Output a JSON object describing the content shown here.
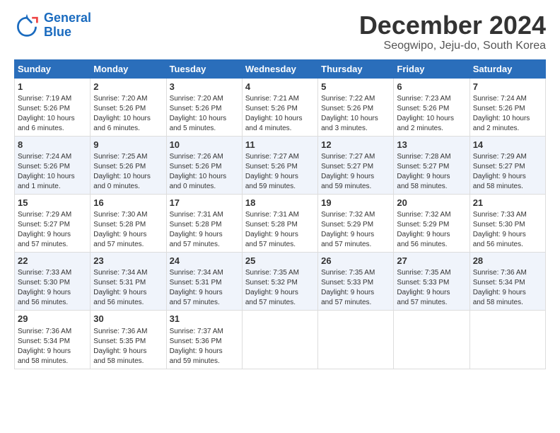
{
  "logo": {
    "line1": "General",
    "line2": "Blue"
  },
  "title": "December 2024",
  "subtitle": "Seogwipo, Jeju-do, South Korea",
  "header_days": [
    "Sunday",
    "Monday",
    "Tuesday",
    "Wednesday",
    "Thursday",
    "Friday",
    "Saturday"
  ],
  "weeks": [
    [
      {
        "day": "1",
        "lines": [
          "Sunrise: 7:19 AM",
          "Sunset: 5:26 PM",
          "Daylight: 10 hours",
          "and 6 minutes."
        ]
      },
      {
        "day": "2",
        "lines": [
          "Sunrise: 7:20 AM",
          "Sunset: 5:26 PM",
          "Daylight: 10 hours",
          "and 6 minutes."
        ]
      },
      {
        "day": "3",
        "lines": [
          "Sunrise: 7:20 AM",
          "Sunset: 5:26 PM",
          "Daylight: 10 hours",
          "and 5 minutes."
        ]
      },
      {
        "day": "4",
        "lines": [
          "Sunrise: 7:21 AM",
          "Sunset: 5:26 PM",
          "Daylight: 10 hours",
          "and 4 minutes."
        ]
      },
      {
        "day": "5",
        "lines": [
          "Sunrise: 7:22 AM",
          "Sunset: 5:26 PM",
          "Daylight: 10 hours",
          "and 3 minutes."
        ]
      },
      {
        "day": "6",
        "lines": [
          "Sunrise: 7:23 AM",
          "Sunset: 5:26 PM",
          "Daylight: 10 hours",
          "and 2 minutes."
        ]
      },
      {
        "day": "7",
        "lines": [
          "Sunrise: 7:24 AM",
          "Sunset: 5:26 PM",
          "Daylight: 10 hours",
          "and 2 minutes."
        ]
      }
    ],
    [
      {
        "day": "8",
        "lines": [
          "Sunrise: 7:24 AM",
          "Sunset: 5:26 PM",
          "Daylight: 10 hours",
          "and 1 minute."
        ]
      },
      {
        "day": "9",
        "lines": [
          "Sunrise: 7:25 AM",
          "Sunset: 5:26 PM",
          "Daylight: 10 hours",
          "and 0 minutes."
        ]
      },
      {
        "day": "10",
        "lines": [
          "Sunrise: 7:26 AM",
          "Sunset: 5:26 PM",
          "Daylight: 10 hours",
          "and 0 minutes."
        ]
      },
      {
        "day": "11",
        "lines": [
          "Sunrise: 7:27 AM",
          "Sunset: 5:26 PM",
          "Daylight: 9 hours",
          "and 59 minutes."
        ]
      },
      {
        "day": "12",
        "lines": [
          "Sunrise: 7:27 AM",
          "Sunset: 5:27 PM",
          "Daylight: 9 hours",
          "and 59 minutes."
        ]
      },
      {
        "day": "13",
        "lines": [
          "Sunrise: 7:28 AM",
          "Sunset: 5:27 PM",
          "Daylight: 9 hours",
          "and 58 minutes."
        ]
      },
      {
        "day": "14",
        "lines": [
          "Sunrise: 7:29 AM",
          "Sunset: 5:27 PM",
          "Daylight: 9 hours",
          "and 58 minutes."
        ]
      }
    ],
    [
      {
        "day": "15",
        "lines": [
          "Sunrise: 7:29 AM",
          "Sunset: 5:27 PM",
          "Daylight: 9 hours",
          "and 57 minutes."
        ]
      },
      {
        "day": "16",
        "lines": [
          "Sunrise: 7:30 AM",
          "Sunset: 5:28 PM",
          "Daylight: 9 hours",
          "and 57 minutes."
        ]
      },
      {
        "day": "17",
        "lines": [
          "Sunrise: 7:31 AM",
          "Sunset: 5:28 PM",
          "Daylight: 9 hours",
          "and 57 minutes."
        ]
      },
      {
        "day": "18",
        "lines": [
          "Sunrise: 7:31 AM",
          "Sunset: 5:28 PM",
          "Daylight: 9 hours",
          "and 57 minutes."
        ]
      },
      {
        "day": "19",
        "lines": [
          "Sunrise: 7:32 AM",
          "Sunset: 5:29 PM",
          "Daylight: 9 hours",
          "and 57 minutes."
        ]
      },
      {
        "day": "20",
        "lines": [
          "Sunrise: 7:32 AM",
          "Sunset: 5:29 PM",
          "Daylight: 9 hours",
          "and 56 minutes."
        ]
      },
      {
        "day": "21",
        "lines": [
          "Sunrise: 7:33 AM",
          "Sunset: 5:30 PM",
          "Daylight: 9 hours",
          "and 56 minutes."
        ]
      }
    ],
    [
      {
        "day": "22",
        "lines": [
          "Sunrise: 7:33 AM",
          "Sunset: 5:30 PM",
          "Daylight: 9 hours",
          "and 56 minutes."
        ]
      },
      {
        "day": "23",
        "lines": [
          "Sunrise: 7:34 AM",
          "Sunset: 5:31 PM",
          "Daylight: 9 hours",
          "and 56 minutes."
        ]
      },
      {
        "day": "24",
        "lines": [
          "Sunrise: 7:34 AM",
          "Sunset: 5:31 PM",
          "Daylight: 9 hours",
          "and 57 minutes."
        ]
      },
      {
        "day": "25",
        "lines": [
          "Sunrise: 7:35 AM",
          "Sunset: 5:32 PM",
          "Daylight: 9 hours",
          "and 57 minutes."
        ]
      },
      {
        "day": "26",
        "lines": [
          "Sunrise: 7:35 AM",
          "Sunset: 5:33 PM",
          "Daylight: 9 hours",
          "and 57 minutes."
        ]
      },
      {
        "day": "27",
        "lines": [
          "Sunrise: 7:35 AM",
          "Sunset: 5:33 PM",
          "Daylight: 9 hours",
          "and 57 minutes."
        ]
      },
      {
        "day": "28",
        "lines": [
          "Sunrise: 7:36 AM",
          "Sunset: 5:34 PM",
          "Daylight: 9 hours",
          "and 58 minutes."
        ]
      }
    ],
    [
      {
        "day": "29",
        "lines": [
          "Sunrise: 7:36 AM",
          "Sunset: 5:34 PM",
          "Daylight: 9 hours",
          "and 58 minutes."
        ]
      },
      {
        "day": "30",
        "lines": [
          "Sunrise: 7:36 AM",
          "Sunset: 5:35 PM",
          "Daylight: 9 hours",
          "and 58 minutes."
        ]
      },
      {
        "day": "31",
        "lines": [
          "Sunrise: 7:37 AM",
          "Sunset: 5:36 PM",
          "Daylight: 9 hours",
          "and 59 minutes."
        ]
      },
      {
        "day": "",
        "lines": []
      },
      {
        "day": "",
        "lines": []
      },
      {
        "day": "",
        "lines": []
      },
      {
        "day": "",
        "lines": []
      }
    ]
  ]
}
